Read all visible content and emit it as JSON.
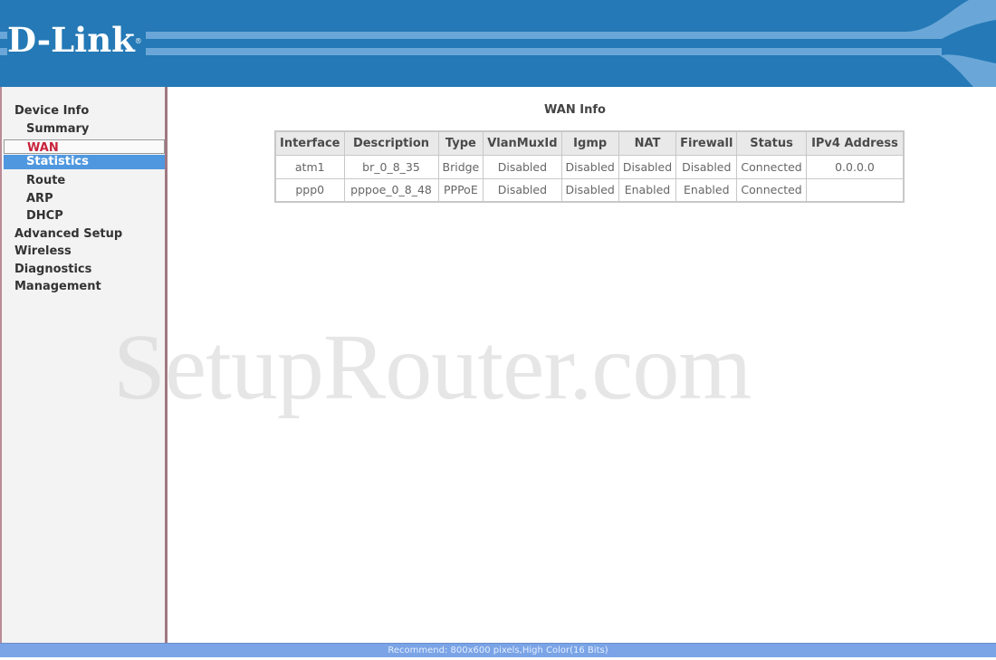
{
  "brand": {
    "logo_text": "D-Link",
    "registered_mark": "®",
    "header_color": "#2479b6",
    "stripe_color": "#6aa7d8"
  },
  "sidebar": {
    "items": [
      {
        "label": "Device Info",
        "level": 0,
        "state": "normal"
      },
      {
        "label": "Summary",
        "level": 1,
        "state": "normal"
      },
      {
        "label": "WAN",
        "level": 1,
        "state": "current"
      },
      {
        "label": "Statistics",
        "level": 1,
        "state": "hover"
      },
      {
        "label": "Route",
        "level": 1,
        "state": "normal"
      },
      {
        "label": "ARP",
        "level": 1,
        "state": "normal"
      },
      {
        "label": "DHCP",
        "level": 1,
        "state": "normal"
      },
      {
        "label": "Advanced Setup",
        "level": 0,
        "state": "normal"
      },
      {
        "label": "Wireless",
        "level": 0,
        "state": "normal"
      },
      {
        "label": "Diagnostics",
        "level": 0,
        "state": "normal"
      },
      {
        "label": "Management",
        "level": 0,
        "state": "normal"
      }
    ],
    "current_color": "#c8243c",
    "hover_color": "#4f98e0"
  },
  "main": {
    "title": "WAN Info",
    "table": {
      "columns": [
        "Interface",
        "Description",
        "Type",
        "VlanMuxId",
        "Igmp",
        "NAT",
        "Firewall",
        "Status",
        "IPv4 Address"
      ],
      "rows": [
        [
          "atm1",
          "br_0_8_35",
          "Bridge",
          "Disabled",
          "Disabled",
          "Disabled",
          "Disabled",
          "Connected",
          "0.0.0.0"
        ],
        [
          "ppp0",
          "pppoe_0_8_48",
          "PPPoE",
          "Disabled",
          "Disabled",
          "Enabled",
          "Enabled",
          "Connected",
          ""
        ]
      ]
    }
  },
  "watermark": "SetupRouter.com",
  "footer": {
    "text": "Recommend: 800x600 pixels,High Color(16 Bits)"
  }
}
